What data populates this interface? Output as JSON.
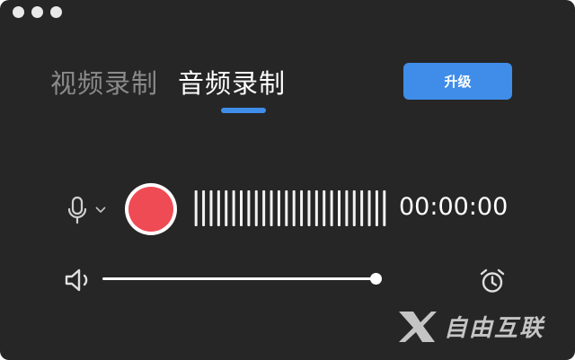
{
  "window": {
    "traffic_lights": [
      "close",
      "minimize",
      "zoom"
    ]
  },
  "tabs": [
    {
      "label": "视频录制",
      "active": false
    },
    {
      "label": "音频录制",
      "active": true
    }
  ],
  "upgrade_button": {
    "label": "升级"
  },
  "recorder": {
    "mic_icon": "microphone-icon",
    "dropdown_icon": "chevron-down-icon",
    "record_icon": "record-icon",
    "timer": "00:00:00"
  },
  "volume": {
    "icon": "speaker-icon",
    "level": 1.0
  },
  "alarm": {
    "icon": "alarm-clock-icon"
  },
  "watermark": {
    "text": "自由互联"
  },
  "colors": {
    "background": "#262626",
    "accent": "#3f8de8",
    "record": "#ef4b55",
    "inactive_tab": "#8a8a8a"
  }
}
